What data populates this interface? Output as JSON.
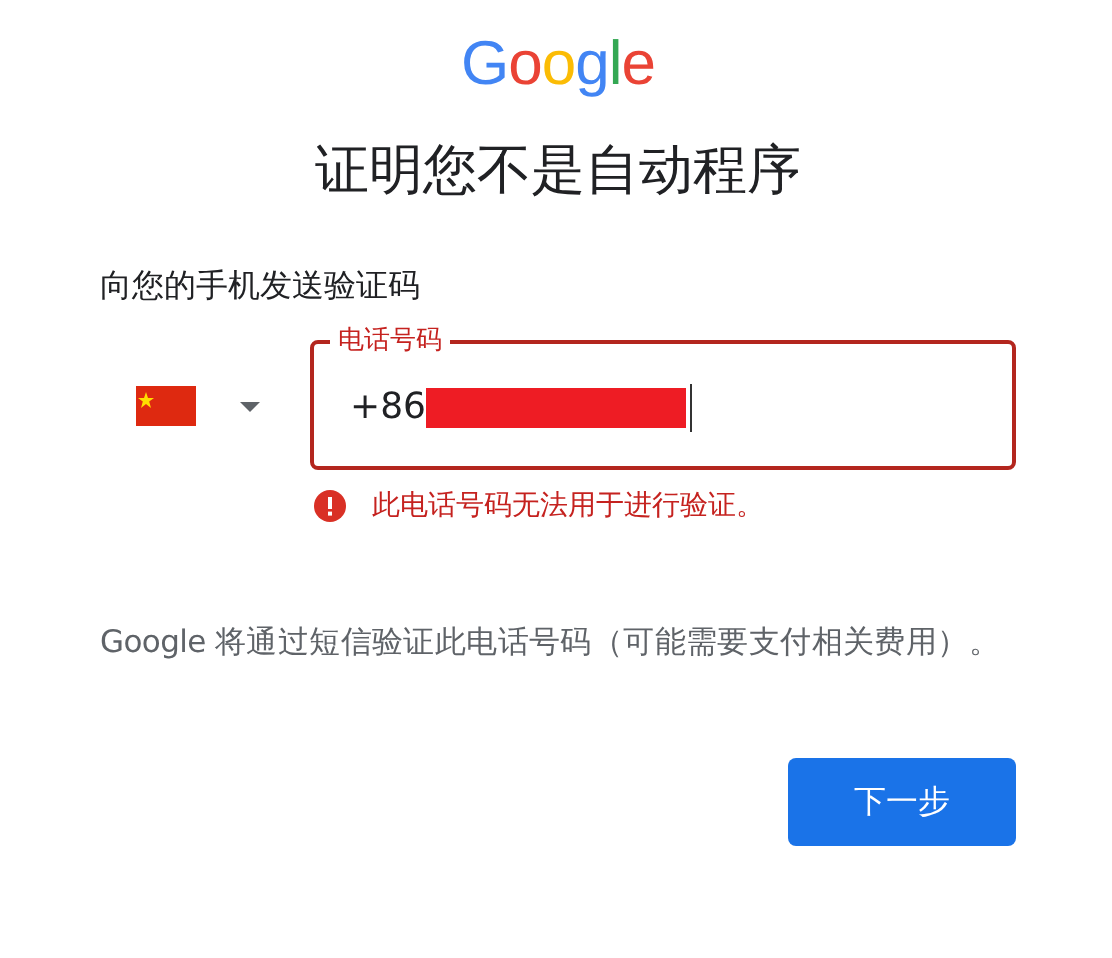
{
  "logo": "Google",
  "title": "证明您不是自动程序",
  "subtitle": "向您的手机发送验证码",
  "phone_field": {
    "label": "电话号码",
    "value": "+86",
    "redacted": true,
    "error": true
  },
  "error_message": "此电话号码无法用于进行验证。",
  "notice": "Google 将通过短信验证此电话号码（可能需要支付相关费用）。",
  "next_button": "下一步"
}
